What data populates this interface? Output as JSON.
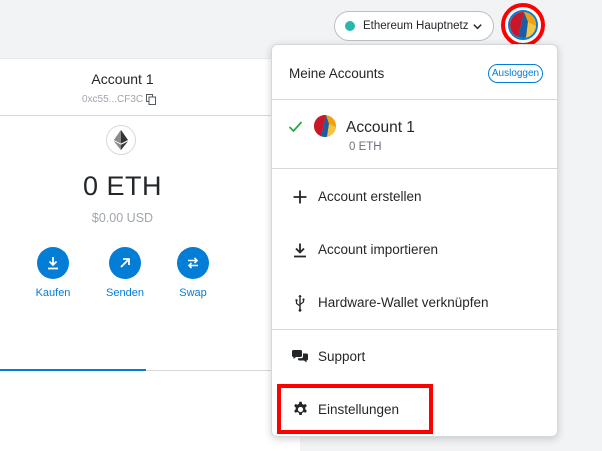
{
  "network": {
    "label": "Ethereum Hauptnetz",
    "dot_color": "#29b6af"
  },
  "wallet": {
    "account_name": "Account 1",
    "address_short": "0xc55...CF3C",
    "balance": "0 ETH",
    "fiat_balance": "$0.00 USD",
    "actions": [
      {
        "label": "Kaufen",
        "icon": "download-icon"
      },
      {
        "label": "Senden",
        "icon": "arrow-up-right-icon"
      },
      {
        "label": "Swap",
        "icon": "swap-icon"
      }
    ]
  },
  "account_menu": {
    "title": "Meine Accounts",
    "logout_label": "Ausloggen",
    "accounts": [
      {
        "name": "Account 1",
        "balance": "0 ETH",
        "selected": true
      }
    ],
    "items": [
      {
        "label": "Account erstellen",
        "icon": "plus-icon"
      },
      {
        "label": "Account importieren",
        "icon": "import-icon"
      },
      {
        "label": "Hardware-Wallet verknüpfen",
        "icon": "usb-icon"
      },
      {
        "label": "Support",
        "icon": "chat-bubbles-icon"
      },
      {
        "label": "Einstellungen",
        "icon": "gear-icon"
      }
    ]
  },
  "colors": {
    "accent": "#037dd6",
    "highlight": "#ff0000",
    "check": "#28a745",
    "network_dot": "#29b6af"
  }
}
